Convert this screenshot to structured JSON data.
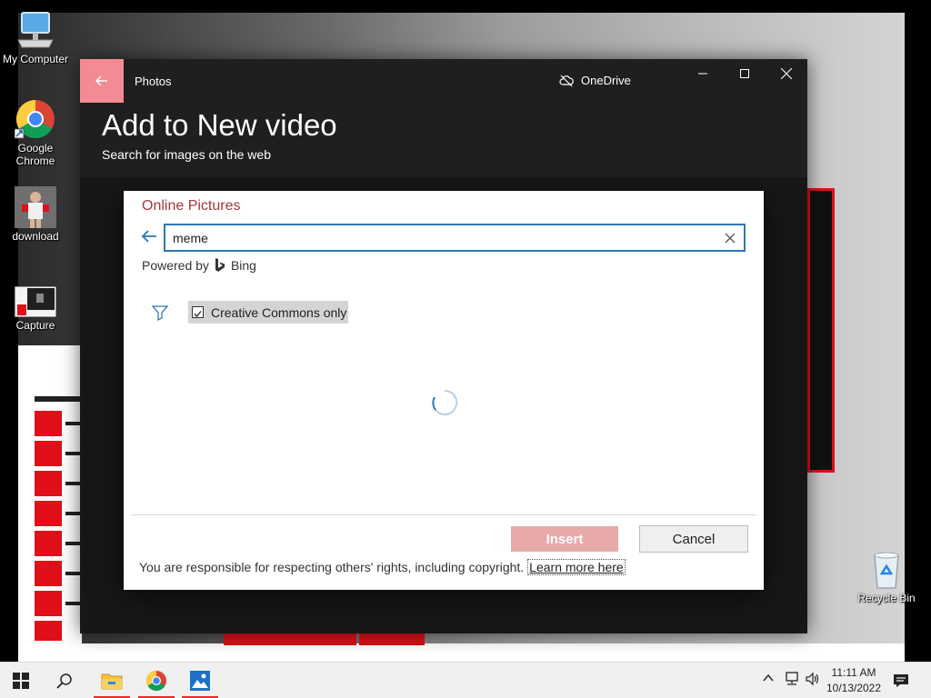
{
  "desktop": {
    "icons": [
      {
        "label": "My Computer"
      },
      {
        "label": "Google Chrome"
      },
      {
        "label": "download"
      },
      {
        "label": "Capture"
      },
      {
        "label": "Recycle Bin"
      }
    ]
  },
  "window": {
    "app_title": "Photos",
    "onedrive_label": "OneDrive",
    "heading": "Add to New video",
    "subheading": "Search for images on the web",
    "accent_color": "#f28b93"
  },
  "dialog": {
    "title": "Online Pictures",
    "search_value": "meme",
    "search_placeholder": "",
    "powered_by": "Powered by",
    "bing_label": "Bing",
    "creative_commons_label": "Creative Commons only",
    "creative_commons_checked": true,
    "insert_label": "Insert",
    "cancel_label": "Cancel",
    "rights_text": "You are responsible for respecting others' rights, including copyright.",
    "learn_more_label": "Learn more here",
    "title_color": "#a4373a",
    "accent_color": "#2b78b8"
  },
  "taskbar": {
    "apps": [
      "start-icon",
      "search-icon",
      "file-explorer-icon",
      "chrome-icon",
      "photos-icon"
    ],
    "time": "11:11 AM",
    "date": "10/13/2022"
  }
}
